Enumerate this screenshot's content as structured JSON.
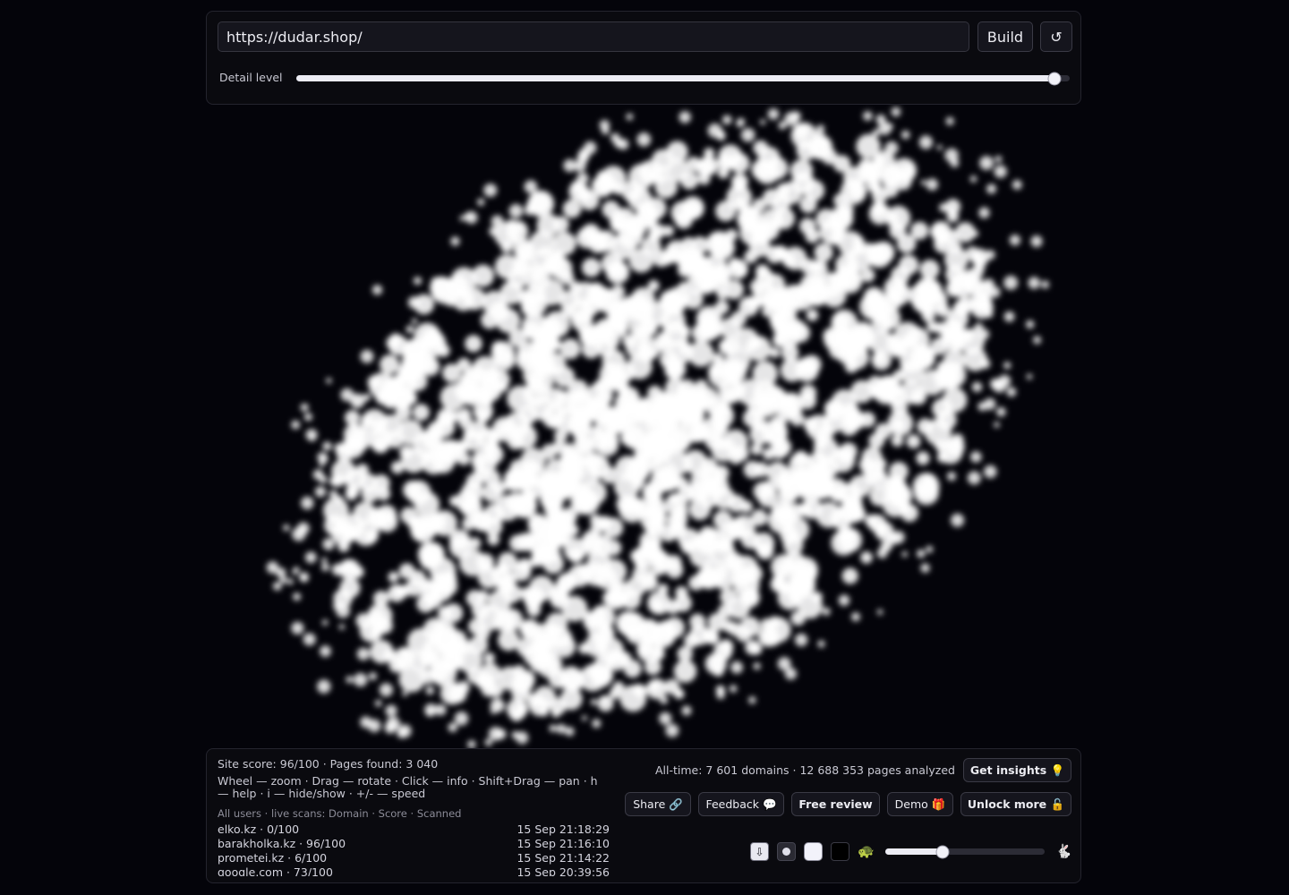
{
  "toolbar": {
    "url_value": "https://dudar.shop/",
    "build_label": "Build",
    "reset_label": "↺",
    "detail_label": "Detail level",
    "detail_level": 0.98
  },
  "stats": {
    "score_line": "Site score: 96/100 · Pages found: 3 040",
    "help_line": "Wheel — zoom · Drag — rotate · Click — info · Shift+Drag — pan · h — help · i — hide/show · +/- — speed",
    "alltime_line": "All-time: 7 601 domains · 12 688 353 pages analyzed"
  },
  "scans": {
    "header": "All users · live scans: Domain · Score · Scanned",
    "rows": [
      {
        "domain": "elko.kz · 0/100",
        "time": "15 Sep 21:18:29"
      },
      {
        "domain": "barakholka.kz · 96/100",
        "time": "15 Sep 21:16:10"
      },
      {
        "domain": "prometei.kz · 6/100",
        "time": "15 Sep 21:14:22"
      },
      {
        "domain": "google.com · 73/100",
        "time": "15 Sep 20:39:56"
      }
    ]
  },
  "actions": {
    "insights_label": "Get insights 💡",
    "share_label": "Share 🔗",
    "feedback_label": "Feedback 💬",
    "free_review_label": "Free review",
    "demo_label": "Demo 🎁",
    "unlock_label": "Unlock more 🔓"
  },
  "controls": {
    "download_icon": "⇩",
    "turtle_icon": "🐢",
    "rabbit_icon": "🐇",
    "speed_level": 0.36
  },
  "colors": {
    "background": "#04040a",
    "particles": "#ffffff"
  }
}
